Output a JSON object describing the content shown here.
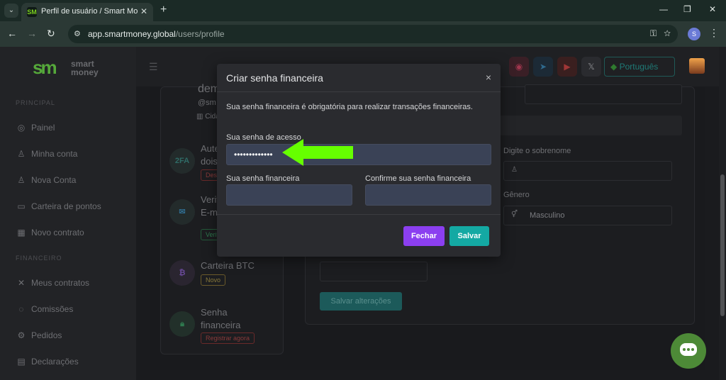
{
  "browser": {
    "tab_title": "Perfil de usuário / Smart Money",
    "favicon_text": "SM",
    "url_host": "app.smartmoney.global",
    "url_path": "/users/profile",
    "profile_initial": "S"
  },
  "sidebar": {
    "logo_mark": "sm",
    "logo_line1": "smart",
    "logo_line2": "money",
    "section_principal": "PRINCIPAL",
    "section_financeiro": "FINANCEIRO",
    "items": [
      {
        "label": "Painel",
        "icon": "palette-icon"
      },
      {
        "label": "Minha conta",
        "icon": "user-icon"
      },
      {
        "label": "Nova Conta",
        "icon": "user-plus-icon"
      },
      {
        "label": "Carteira de pontos",
        "icon": "wallet-icon"
      },
      {
        "label": "Novo contrato",
        "icon": "chart-icon"
      },
      {
        "label": "Meus contratos",
        "icon": "tools-icon"
      },
      {
        "label": "Comissões",
        "icon": "settings-icon"
      },
      {
        "label": "Pedidos",
        "icon": "orders-icon"
      },
      {
        "label": "Declarações",
        "icon": "document-icon"
      }
    ]
  },
  "topbar": {
    "language": "Português"
  },
  "profile_cards": {
    "name_partial": "dem",
    "email_partial": "@sm",
    "city_partial": "Cidad",
    "twofa_title": "Aute dois",
    "twofa_icon": "2FA",
    "twofa_badge": "Desa",
    "email_title": "Verif E-m",
    "email_badge": "Verif",
    "btc_title": "Carteira BTC",
    "btc_badge": "Novo",
    "fin_title_1": "Senha",
    "fin_title_2": "financeira",
    "fin_badge": "Registrar agora"
  },
  "form": {
    "surname_label": "Digite o sobrenome",
    "gender_label": "Gênero",
    "gender_value": "Masculino",
    "save_changes": "Salvar alterações"
  },
  "modal": {
    "title": "Criar senha financeira",
    "close_glyph": "×",
    "description": "Sua senha financeira é obrigatória para realizar transações financeiras.",
    "access_label": "Sua senha de acesso",
    "access_value": "•••••••••••••",
    "financial_label": "Sua senha financeira",
    "confirm_label": "Confirme sua senha financeira",
    "cancel_label": "Fechar",
    "save_label": "Salvar"
  },
  "colors": {
    "accent_purple": "#8b3ff0",
    "accent_teal": "#14a9a3",
    "arrow_green": "#66ff00",
    "brand_green": "#55a83a"
  }
}
